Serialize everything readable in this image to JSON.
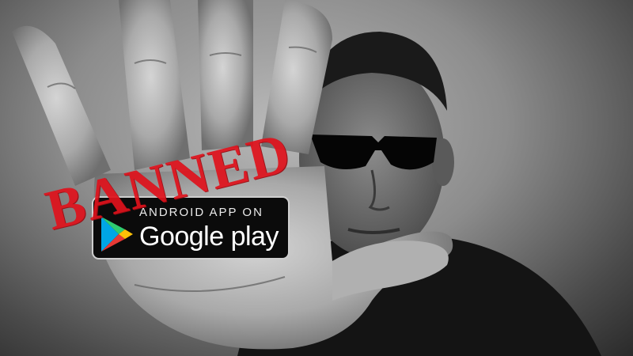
{
  "badge": {
    "eyebrow": "ANDROID APP ON",
    "title": "Google play",
    "icon": "google-play-icon"
  },
  "stamp": {
    "text": "BANNED",
    "color": "#e0121c"
  }
}
